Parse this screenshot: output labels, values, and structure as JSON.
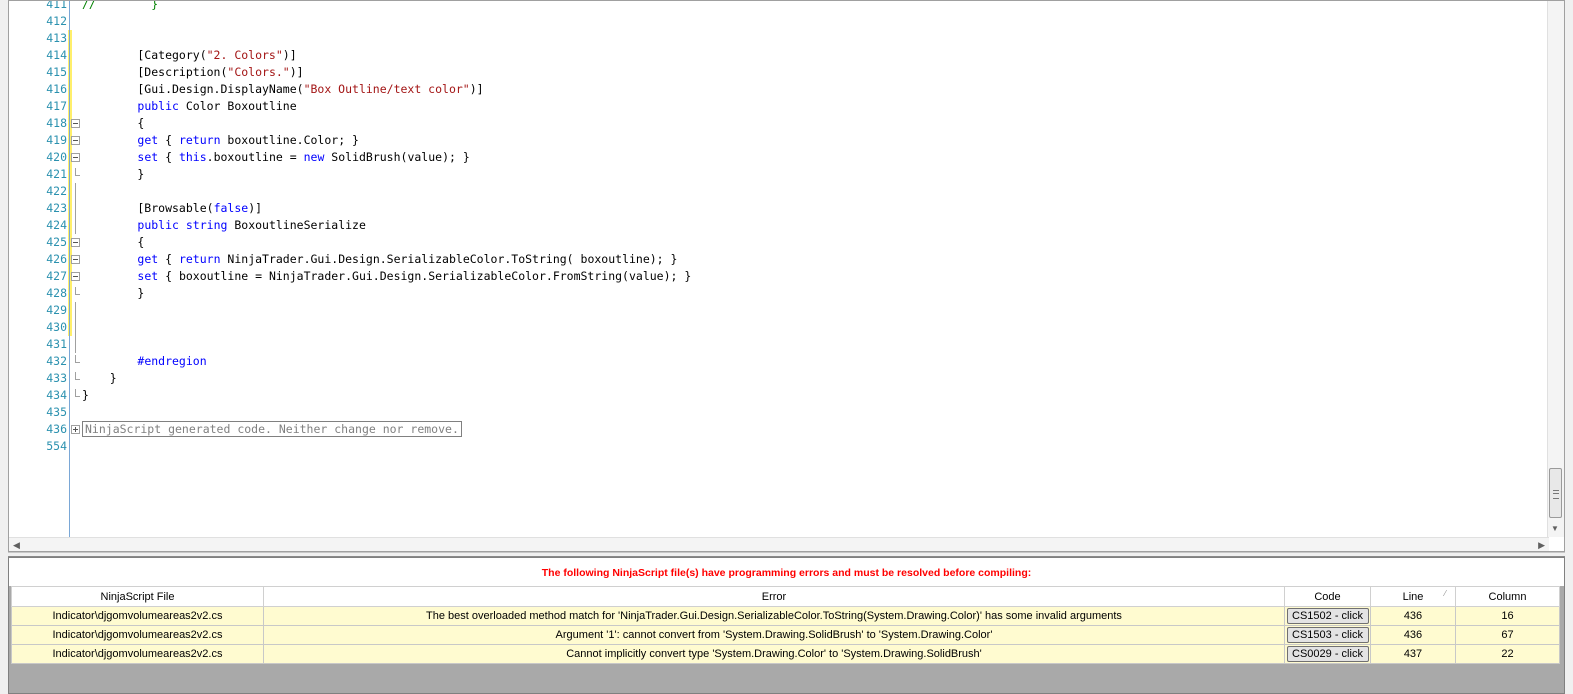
{
  "editor": {
    "lines": [
      {
        "num": "411",
        "code": [
          {
            "t": "//        }",
            "c": "cm"
          }
        ]
      },
      {
        "num": "412",
        "code": []
      },
      {
        "num": "413",
        "code": []
      },
      {
        "num": "414",
        "code": [
          {
            "t": "        [Category("
          },
          {
            "t": "\"2. Colors\"",
            "c": "str"
          },
          {
            "t": ")]"
          }
        ]
      },
      {
        "num": "415",
        "code": [
          {
            "t": "        [Description("
          },
          {
            "t": "\"Colors.\"",
            "c": "str"
          },
          {
            "t": ")]"
          }
        ]
      },
      {
        "num": "416",
        "code": [
          {
            "t": "        [Gui.Design.DisplayName("
          },
          {
            "t": "\"Box Outline/text color\"",
            "c": "str"
          },
          {
            "t": ")]"
          }
        ]
      },
      {
        "num": "417",
        "code": [
          {
            "t": "        "
          },
          {
            "t": "public",
            "c": "kw"
          },
          {
            "t": " Color Boxoutline"
          }
        ]
      },
      {
        "num": "418",
        "code": [
          {
            "t": "        {"
          }
        ]
      },
      {
        "num": "419",
        "code": [
          {
            "t": "        "
          },
          {
            "t": "get",
            "c": "kw"
          },
          {
            "t": " { "
          },
          {
            "t": "return",
            "c": "kw"
          },
          {
            "t": " boxoutline.Color; }"
          }
        ]
      },
      {
        "num": "420",
        "code": [
          {
            "t": "        "
          },
          {
            "t": "set",
            "c": "kw"
          },
          {
            "t": " { "
          },
          {
            "t": "this",
            "c": "kw"
          },
          {
            "t": ".boxoutline = "
          },
          {
            "t": "new",
            "c": "kw"
          },
          {
            "t": " SolidBrush(value); }"
          }
        ]
      },
      {
        "num": "421",
        "code": [
          {
            "t": "        }"
          }
        ]
      },
      {
        "num": "422",
        "code": []
      },
      {
        "num": "423",
        "code": [
          {
            "t": "        [Browsable("
          },
          {
            "t": "false",
            "c": "kw"
          },
          {
            "t": ")]"
          }
        ]
      },
      {
        "num": "424",
        "code": [
          {
            "t": "        "
          },
          {
            "t": "public",
            "c": "kw"
          },
          {
            "t": " "
          },
          {
            "t": "string",
            "c": "kw"
          },
          {
            "t": " BoxoutlineSerialize"
          }
        ]
      },
      {
        "num": "425",
        "code": [
          {
            "t": "        {"
          }
        ]
      },
      {
        "num": "426",
        "code": [
          {
            "t": "        "
          },
          {
            "t": "get",
            "c": "kw"
          },
          {
            "t": " { "
          },
          {
            "t": "return",
            "c": "kw"
          },
          {
            "t": " NinjaTrader.Gui.Design.SerializableColor.ToString( boxoutline); }"
          }
        ]
      },
      {
        "num": "427",
        "code": [
          {
            "t": "        "
          },
          {
            "t": "set",
            "c": "kw"
          },
          {
            "t": " { boxoutline = NinjaTrader.Gui.Design.SerializableColor.FromString(value); }"
          }
        ]
      },
      {
        "num": "428",
        "code": [
          {
            "t": "        }"
          }
        ]
      },
      {
        "num": "429",
        "code": []
      },
      {
        "num": "430",
        "code": []
      },
      {
        "num": "431",
        "code": []
      },
      {
        "num": "432",
        "code": [
          {
            "t": "        "
          },
          {
            "t": "#endregion",
            "c": "kw"
          }
        ]
      },
      {
        "num": "433",
        "code": [
          {
            "t": "    }"
          }
        ]
      },
      {
        "num": "434",
        "code": [
          {
            "t": "}"
          }
        ]
      },
      {
        "num": "435",
        "code": []
      },
      {
        "num": "436",
        "code": [
          {
            "t": "NinjaScript generated code. Neither change nor remove.",
            "c": "region"
          }
        ]
      },
      {
        "num": "554",
        "code": []
      }
    ]
  },
  "errors": {
    "message": "The following NinjaScript file(s) have programming errors and must be resolved before compiling:",
    "columns": [
      "NinjaScript File",
      "Error",
      "Code",
      "Line",
      "Column"
    ],
    "rows": [
      {
        "file": "Indicator\\djgomvolumeareas2v2.cs",
        "error": "The best overloaded method match for 'NinjaTrader.Gui.Design.SerializableColor.ToString(System.Drawing.Color)' has some invalid arguments",
        "code": "CS1502 - click",
        "line": "436",
        "column": "16"
      },
      {
        "file": "Indicator\\djgomvolumeareas2v2.cs",
        "error": "Argument '1': cannot convert from 'System.Drawing.SolidBrush' to 'System.Drawing.Color'",
        "code": "CS1503 - click",
        "line": "436",
        "column": "67"
      },
      {
        "file": "Indicator\\djgomvolumeareas2v2.cs",
        "error": "Cannot implicitly convert type 'System.Drawing.Color' to 'System.Drawing.SolidBrush'",
        "code": "CS0029 - click",
        "line": "437",
        "column": "22"
      }
    ]
  },
  "icons": {
    "scroll_up": "chevron-up-icon",
    "scroll_down": "chevron-down-icon",
    "scroll_left": "chevron-left-icon",
    "scroll_right": "chevron-right-icon",
    "fold": "collapse-icon",
    "expand": "expand-icon",
    "sort": "sort-icon"
  },
  "colors": {
    "line_numbers": "#2b91af",
    "keyword": "#0000ff",
    "string": "#a31515",
    "comment": "#008000",
    "error_text": "#ff0000",
    "error_row": "#fffbd0",
    "change_marker": "#ffef6b"
  }
}
